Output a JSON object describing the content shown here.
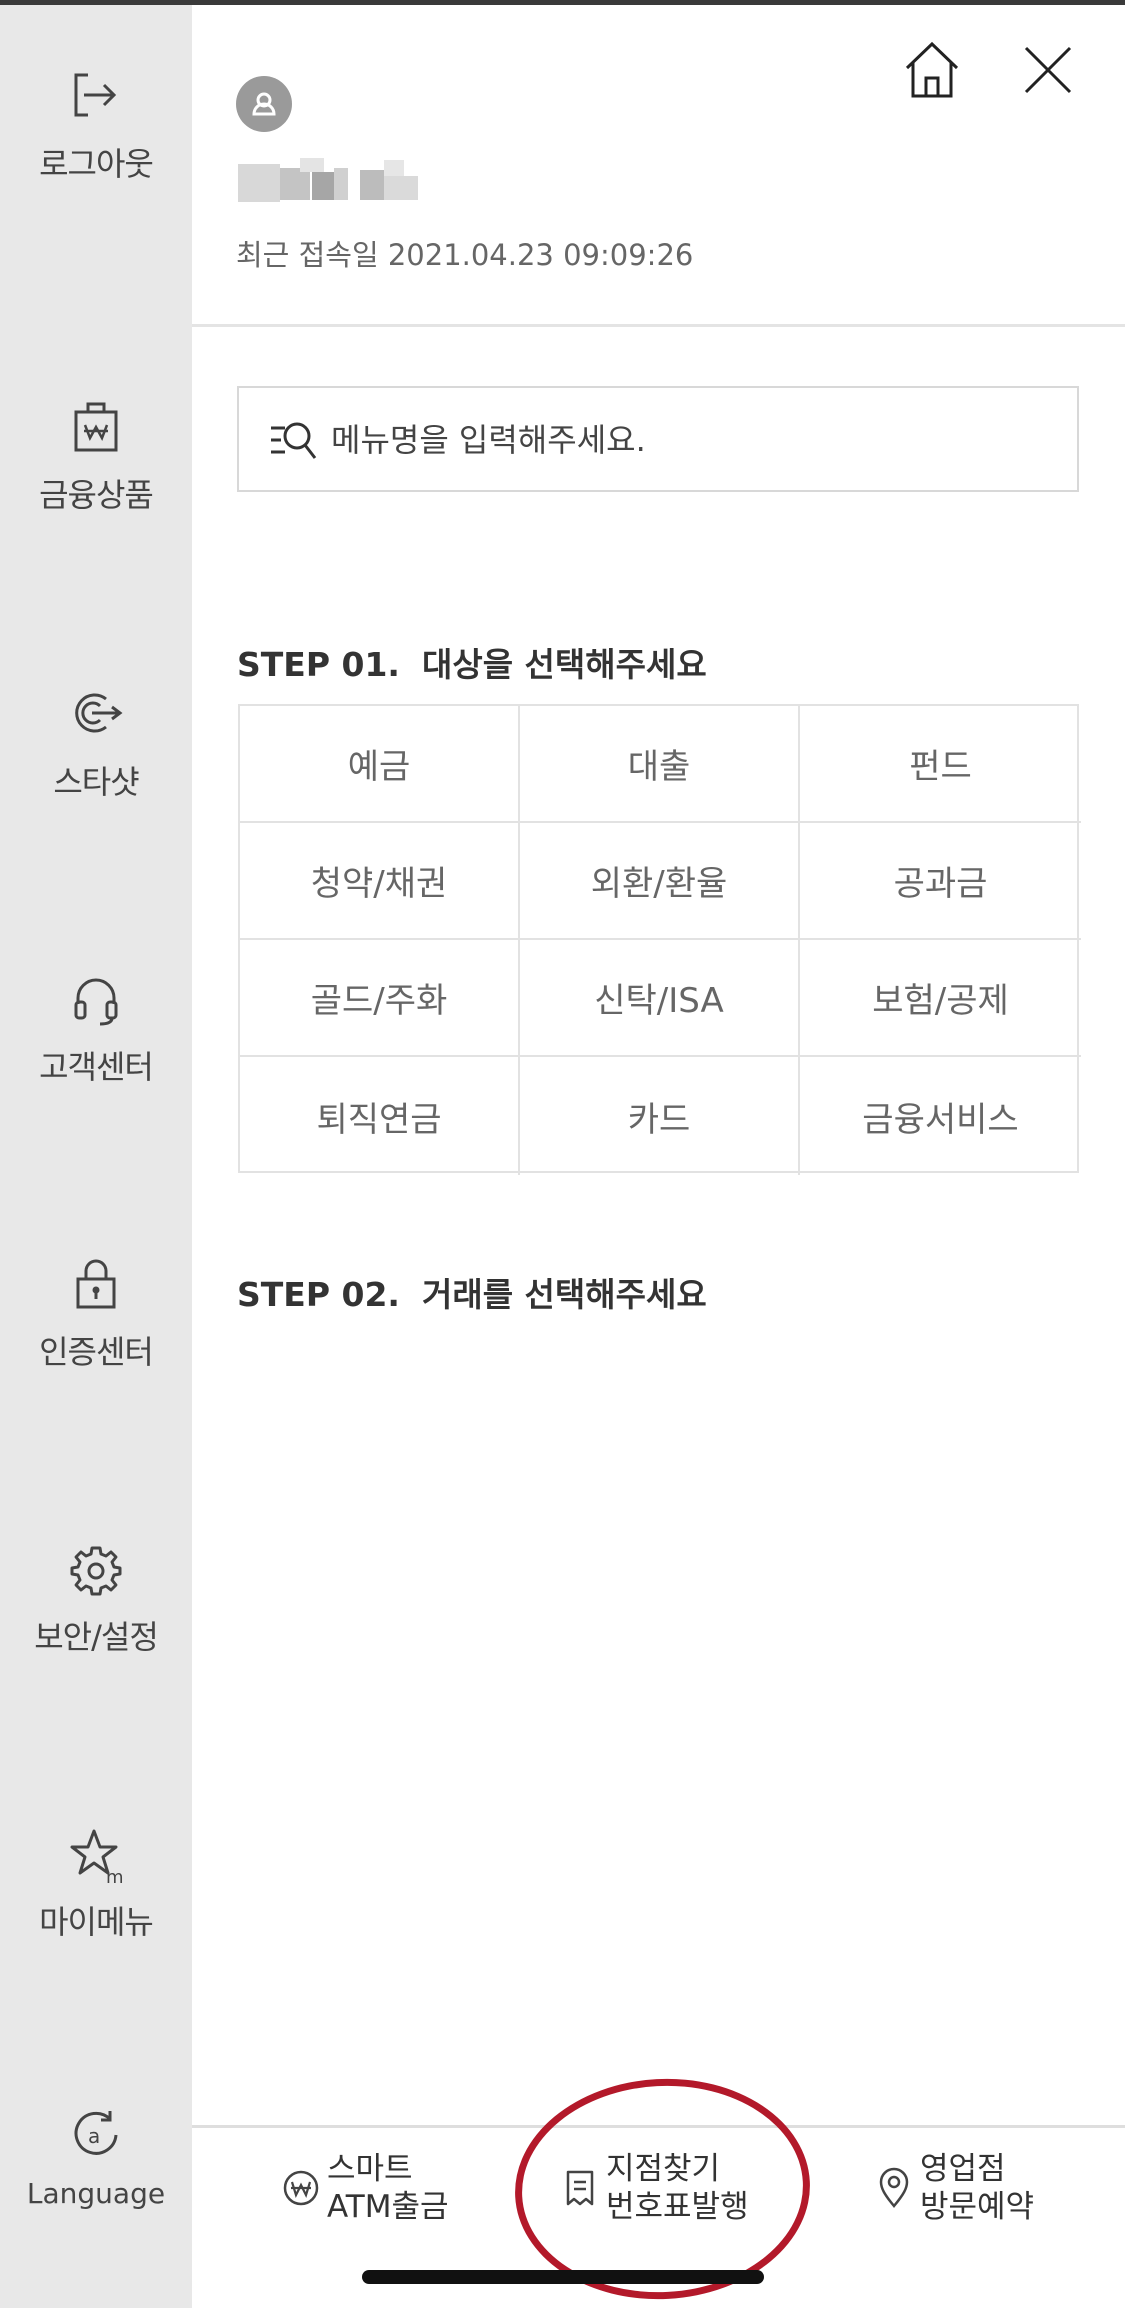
{
  "sidebar": {
    "items": [
      {
        "label": "로그아웃",
        "icon": "logout-icon"
      },
      {
        "label": "금융상품",
        "icon": "financial-products-icon"
      },
      {
        "label": "스타샷",
        "icon": "starshot-icon"
      },
      {
        "label": "고객센터",
        "icon": "headset-icon"
      },
      {
        "label": "인증센터",
        "icon": "lock-icon"
      },
      {
        "label": "보안/설정",
        "icon": "gear-icon"
      },
      {
        "label": "마이메뉴",
        "icon": "star-m-icon"
      },
      {
        "label": "Language",
        "icon": "language-icon"
      }
    ]
  },
  "header": {
    "last_login": "최근 접속일 2021.04.23 09:09:26",
    "home_icon": "home-icon",
    "close_icon": "close-icon"
  },
  "search": {
    "placeholder": "메뉴명을 입력해주세요."
  },
  "step1": {
    "num": "STEP 01.",
    "title": "대상을 선택해주세요",
    "categories": [
      "예금",
      "대출",
      "펀드",
      "청약/채권",
      "외환/환율",
      "공과금",
      "골드/주화",
      "신탁/ISA",
      "보험/공제",
      "퇴직연금",
      "카드",
      "금융서비스"
    ]
  },
  "step2": {
    "num": "STEP 02.",
    "title": "거래를 선택해주세요"
  },
  "bottom": {
    "atm": {
      "line1": "스마트",
      "line2": "ATM출금",
      "icon": "won-coin-icon"
    },
    "branch": {
      "line1": "지점찾기",
      "line2": "번호표발행",
      "icon": "ticket-icon"
    },
    "visit": {
      "line1": "영업점",
      "line2": "방문예약",
      "icon": "location-pin-icon"
    }
  },
  "colors": {
    "sidebar_bg": "#e8e8e8",
    "annotation_circle": "#b3192a"
  }
}
